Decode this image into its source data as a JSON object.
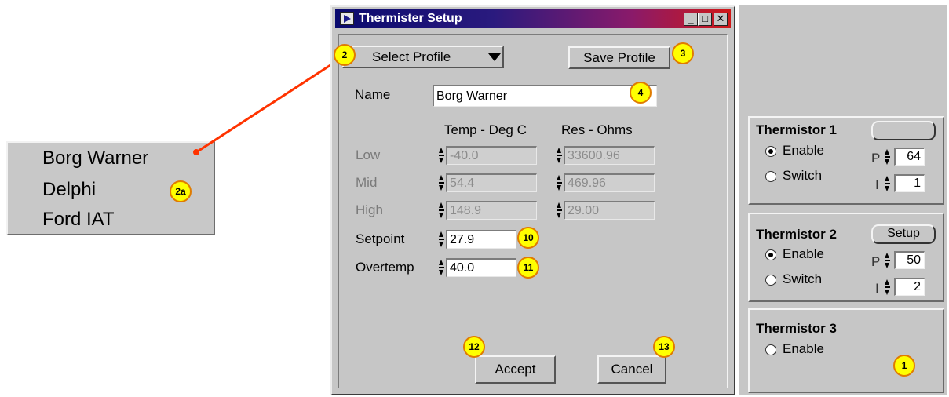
{
  "popup": {
    "options": [
      "Borg Warner",
      "Delphi",
      "Ford IAT"
    ]
  },
  "dialog": {
    "title": "Thermister Setup",
    "window_buttons": {
      "minimize": "_",
      "maximize": "□",
      "close": "✕"
    },
    "select_profile_label": "Select Profile",
    "save_profile_label": "Save Profile",
    "name_label": "Name",
    "name_value": "Borg Warner",
    "col_temp_header": "Temp - Deg C",
    "col_res_header": "Res - Ohms",
    "rows": [
      {
        "label": "Low",
        "temp": "-40.0",
        "res": "33600.96"
      },
      {
        "label": "Mid",
        "temp": "54.4",
        "res": "469.96"
      },
      {
        "label": "High",
        "temp": "148.9",
        "res": "29.00"
      }
    ],
    "setpoint_label": "Setpoint",
    "setpoint_value": "27.9",
    "overtemp_label": "Overtemp",
    "overtemp_value": "40.0",
    "accept_label": "Accept",
    "cancel_label": "Cancel"
  },
  "thermistors": [
    {
      "title": "Thermistor 1",
      "setup_label": "",
      "enable_label": "Enable",
      "switch_label": "Switch",
      "p_label": "P",
      "i_label": "I",
      "p_value": "64",
      "i_value": "1"
    },
    {
      "title": "Thermistor 2",
      "setup_label": "Setup",
      "enable_label": "Enable",
      "switch_label": "Switch",
      "p_label": "P",
      "i_label": "I",
      "p_value": "50",
      "i_value": "2"
    },
    {
      "title": "Thermistor 3",
      "enable_label": "Enable"
    }
  ],
  "callouts": {
    "c1": "1",
    "c2": "2",
    "c2a": "2a",
    "c3": "3",
    "c4": "4",
    "c10": "10",
    "c11": "11",
    "c12": "12",
    "c13": "13"
  },
  "colors": {
    "callout_fill": "#ffff00",
    "callout_border": "#e07b00",
    "connector": "#ff3300"
  }
}
